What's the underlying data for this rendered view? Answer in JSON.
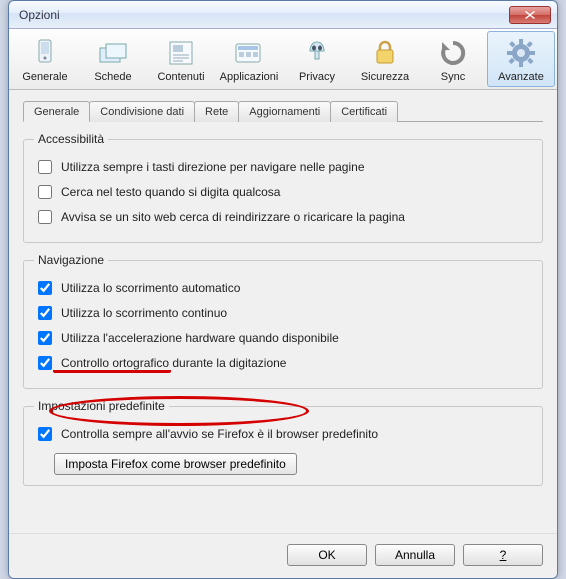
{
  "window": {
    "title": "Opzioni"
  },
  "toolbar": [
    {
      "label": "Generale"
    },
    {
      "label": "Schede"
    },
    {
      "label": "Contenuti"
    },
    {
      "label": "Applicazioni"
    },
    {
      "label": "Privacy"
    },
    {
      "label": "Sicurezza"
    },
    {
      "label": "Sync"
    },
    {
      "label": "Avanzate"
    }
  ],
  "tabs": [
    {
      "label": "Generale"
    },
    {
      "label": "Condivisione dati"
    },
    {
      "label": "Rete"
    },
    {
      "label": "Aggiornamenti"
    },
    {
      "label": "Certificati"
    }
  ],
  "access": {
    "legend": "Accessibilità",
    "opt1": "Utilizza sempre i tasti direzione per navigare nelle pagine",
    "opt2": "Cerca nel testo quando si digita qualcosa",
    "opt3": "Avvisa se un sito web cerca di reindirizzare o ricaricare la pagina"
  },
  "nav": {
    "legend": "Navigazione",
    "opt1": "Utilizza lo scorrimento automatico",
    "opt2": "Utilizza lo scorrimento continuo",
    "opt3": "Utilizza l'accelerazione hardware quando disponibile",
    "opt4": "Controllo ortografico durante la digitazione"
  },
  "defaults": {
    "legend": "Impostazioni predefinite",
    "opt1": "Controlla sempre all'avvio se Firefox è il browser predefinito",
    "btn": "Imposta Firefox come browser predefinito"
  },
  "buttons": {
    "ok": "OK",
    "cancel": "Annulla",
    "help": "?"
  }
}
